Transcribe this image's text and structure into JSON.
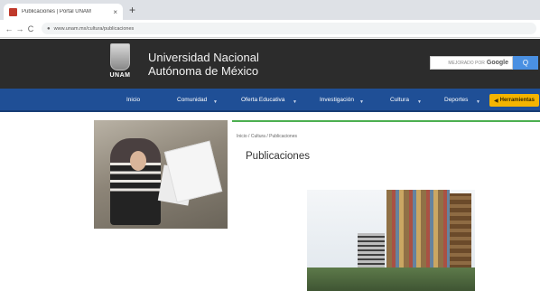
{
  "browser": {
    "tab_title": "Publicaciones | Portal UNAM",
    "tab_close": "×",
    "new_tab": "+",
    "back": "←",
    "forward": "→",
    "reload": "C",
    "url": "www.unam.mx/cultura/publicaciones"
  },
  "header": {
    "logo_text": "UNAM",
    "name_line1": "Universidad Nacional",
    "name_line2": "Autónoma de México",
    "search_placeholder": "MEJORADO POR",
    "search_brand": "Google",
    "search_button": "Q"
  },
  "nav": {
    "items": [
      "Inicio",
      "Comunidad",
      "Oferta Educativa",
      "Investigación",
      "Cultura",
      "Deportes"
    ],
    "cta_label": "Herramientas"
  },
  "content": {
    "breadcrumb": "Inicio / Cultura / Publicaciones",
    "title": "Publicaciones"
  },
  "colors": {
    "header_bg": "#2c2c2c",
    "nav_bg": "#1f4f96",
    "accent_green": "#4caf50",
    "cta_yellow": "#f4b400"
  }
}
